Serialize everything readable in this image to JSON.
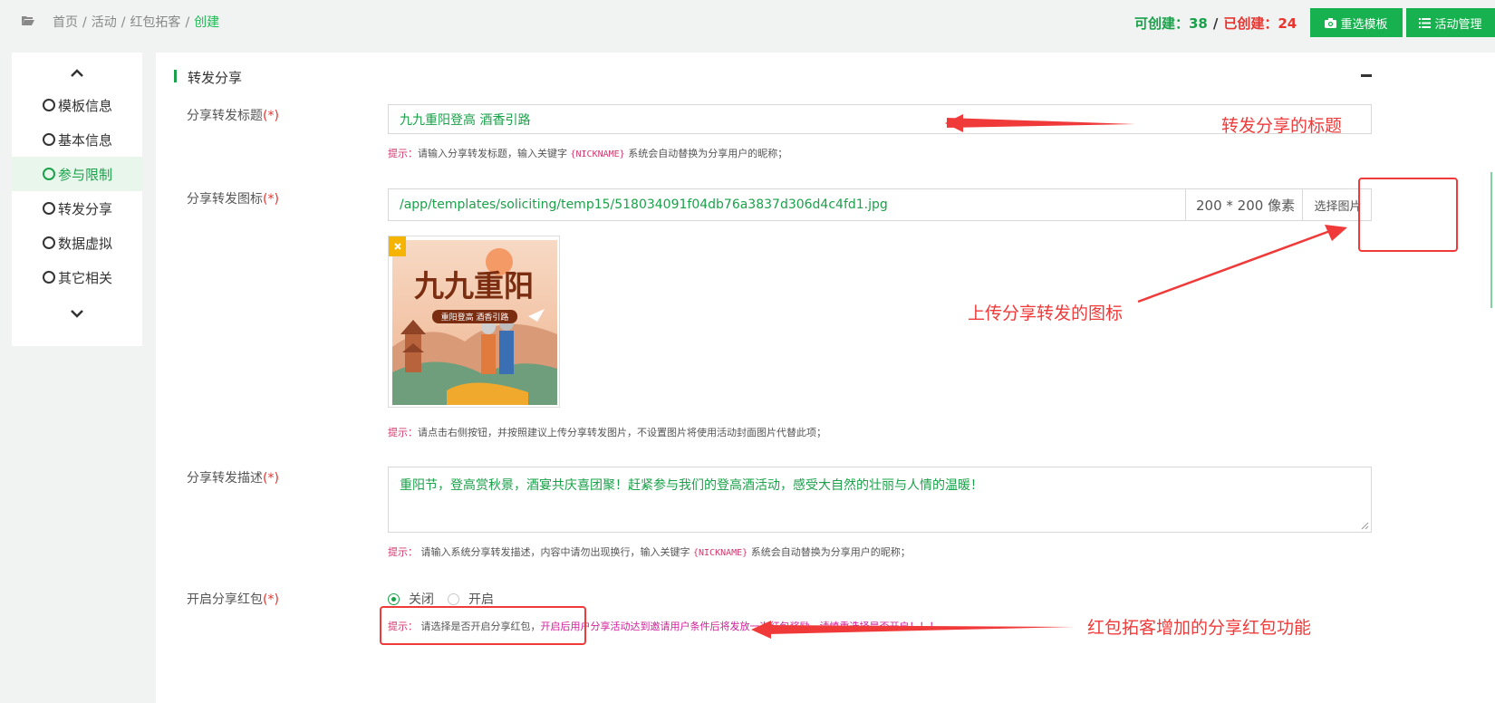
{
  "breadcrumb": {
    "items": [
      "首页",
      "活动",
      "红包拓客"
    ],
    "current": "创建"
  },
  "quota": {
    "can_create_label": "可创建：38",
    "separator": "/",
    "created_label": "已创建：24"
  },
  "toolbar": {
    "reselect_template": "重选模板",
    "activity_manage": "活动管理"
  },
  "sidebar": {
    "items": [
      {
        "label": "模板信息"
      },
      {
        "label": "基本信息"
      },
      {
        "label": "参与限制"
      },
      {
        "label": "转发分享"
      },
      {
        "label": "数据虚拟"
      },
      {
        "label": "其它相关"
      }
    ],
    "active_index": 2
  },
  "section": {
    "title": "转发分享"
  },
  "form": {
    "share_title": {
      "label": "分享转发标题",
      "required_mark": "(*)",
      "value": "九九重阳登高 酒香引路",
      "hint_lead": "提示：",
      "hint_a": "请输入分享转发标题，输入关键字 ",
      "hint_code": "{NICKNAME}",
      "hint_b": " 系统会自动替换为分享用户的昵称；"
    },
    "share_icon": {
      "label": "分享转发图标",
      "required_mark": "(*)",
      "value": "/app/templates/soliciting/temp15/518034091f04db76a3837d306d4c4fd1.jpg",
      "size_hint": "200 * 200 像素",
      "choose_button": "选择图片",
      "thumb_title": "九九重阳",
      "thumb_subtitle": "重阳登高 酒香引路",
      "hint_lead": "提示：",
      "hint": "请点击右侧按钮，并按照建议上传分享转发图片，不设置图片将使用活动封面图片代替此项；"
    },
    "share_desc": {
      "label": "分享转发描述",
      "required_mark": "(*)",
      "value": "重阳节，登高赏秋景，酒宴共庆喜团聚！赶紧参与我们的登高酒活动，感受大自然的壮丽与人情的温暖！",
      "hint_lead": "提示：",
      "hint_a": " 请输入系统分享转发描述，内容中请勿出现换行，输入关键字 ",
      "hint_code": "{NICKNAME}",
      "hint_b": " 系统会自动替换为分享用户的昵称；"
    },
    "share_redpacket": {
      "label": "开启分享红包",
      "required_mark": "(*)",
      "options": [
        "关闭",
        "开启"
      ],
      "selected": "关闭",
      "hint_lead": "提示：",
      "hint_a": " 请选择是否开启分享红包，",
      "hint_warn": "开启后用户分享活动达到邀请用户条件后将发放一次红包奖励，请慎重选择是否开启！！！"
    }
  },
  "annotations": {
    "title_note": "转发分享的标题",
    "icon_note": "上传分享转发的图标",
    "redpacket_note": "红包拓客增加的分享红包功能",
    "color": "#f03a3a"
  },
  "colors": {
    "brand_green": "#17b24f",
    "text_green": "#1aa14a",
    "alert_red": "#e8332e",
    "hint_pink": "#d13a6c"
  }
}
